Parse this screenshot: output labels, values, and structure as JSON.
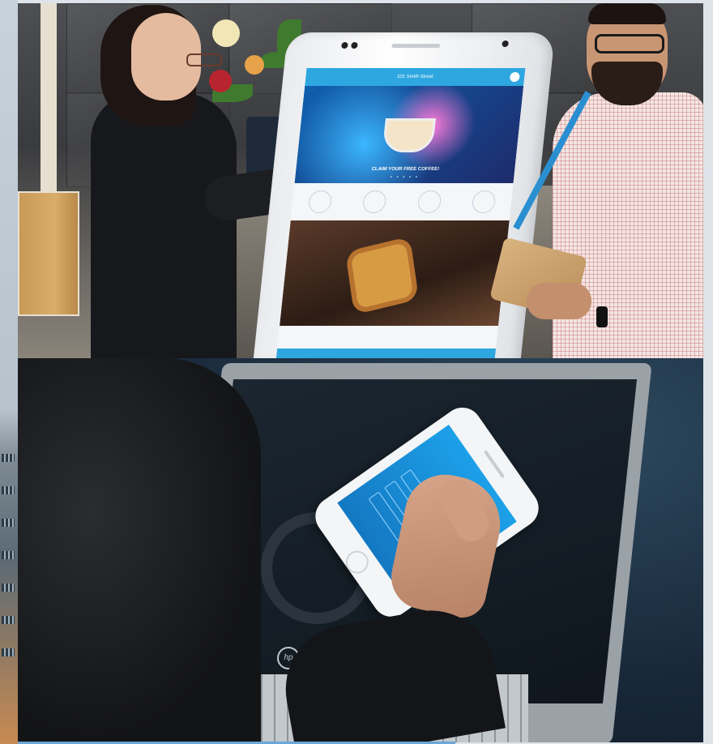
{
  "kiosk_app": {
    "header_title": "101 Smith Street",
    "hero_caption": "CLAIM YOUR FREE COFFEE!",
    "carousel_dots": "• • • • •"
  },
  "laptop": {
    "logo": "hp"
  },
  "colors": {
    "accent": "#2ea7e0",
    "phone_screen": "#1c9ce4",
    "lanyard": "#2a8fd1"
  }
}
